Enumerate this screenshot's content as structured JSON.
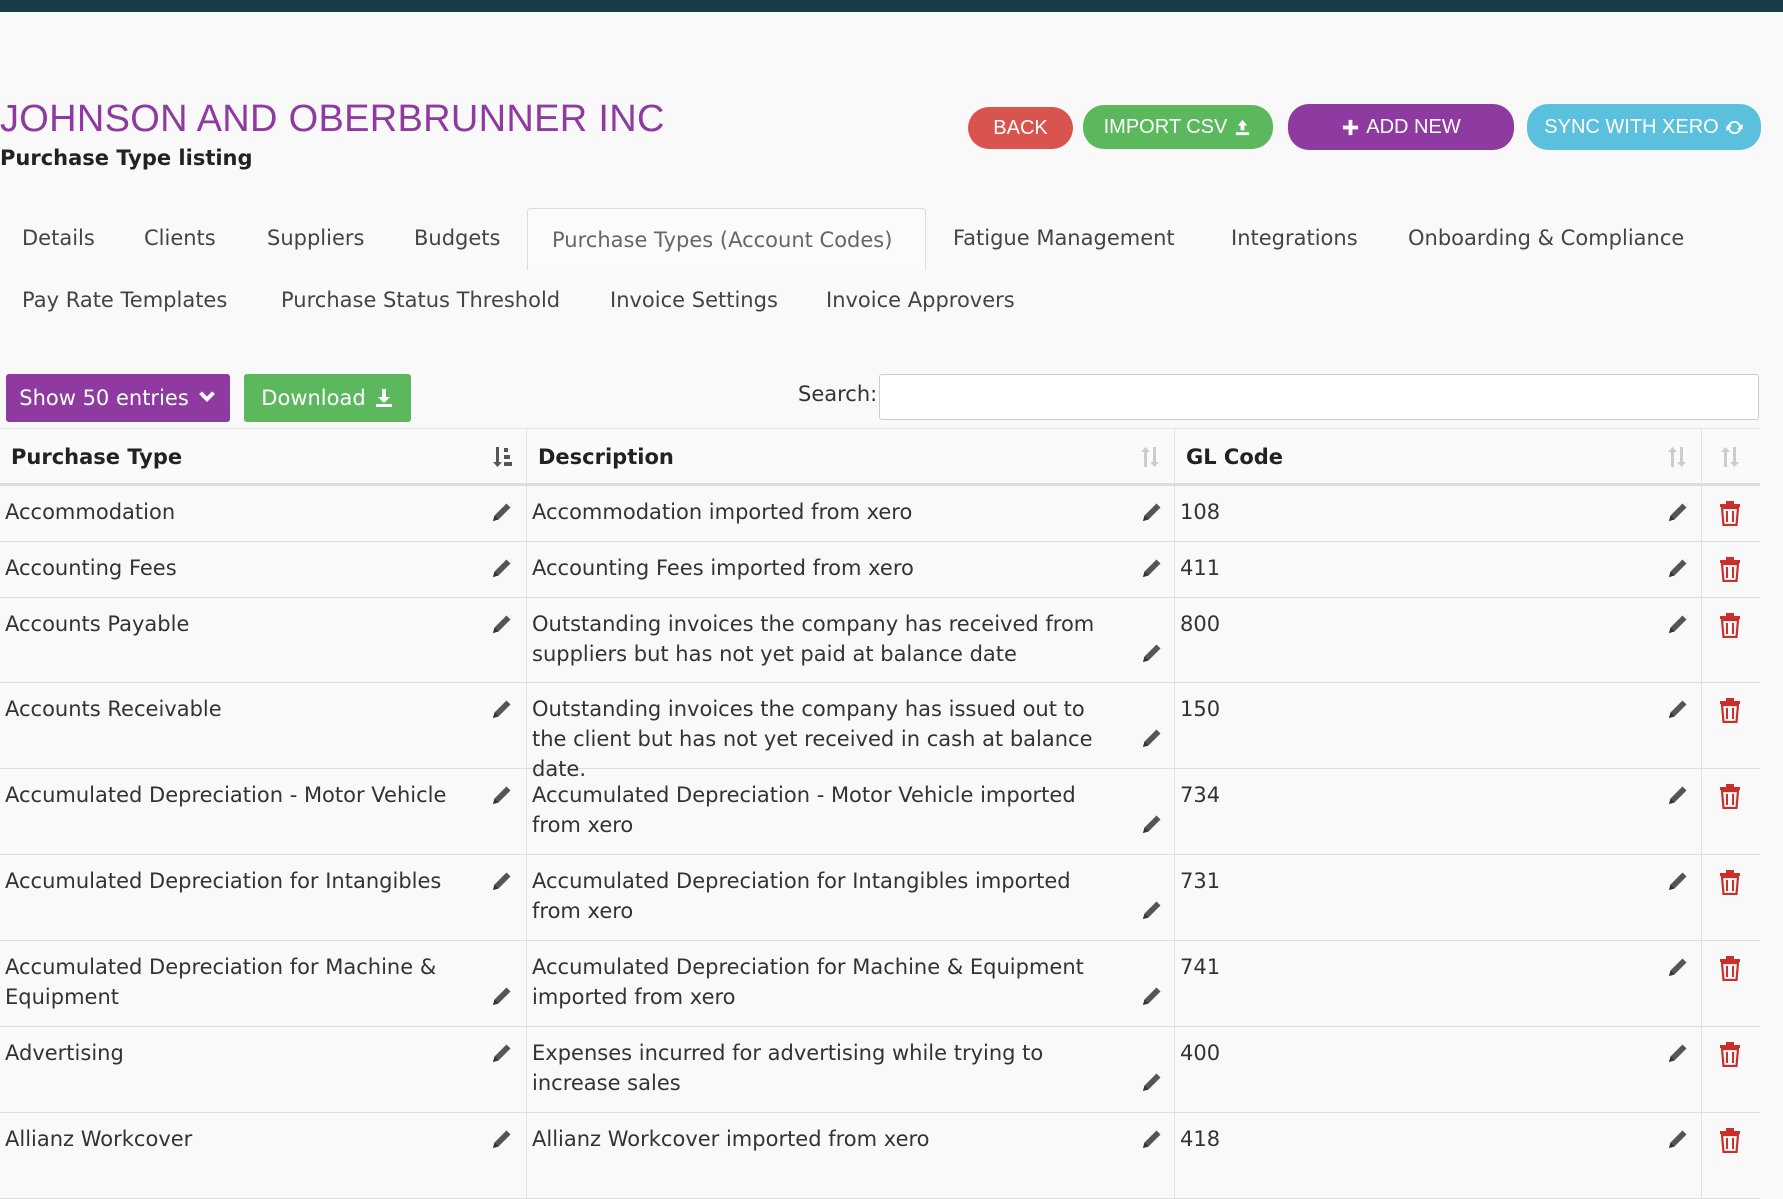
{
  "header": {
    "company": "JOHNSON AND OBERBRUNNER INC",
    "subtitle": "Purchase Type listing",
    "buttons": {
      "back": "BACK",
      "import": "IMPORT CSV",
      "add": "ADD NEW",
      "sync": "SYNC WITH XERO"
    }
  },
  "tabs": [
    {
      "label": "Details"
    },
    {
      "label": "Clients"
    },
    {
      "label": "Suppliers"
    },
    {
      "label": "Budgets"
    },
    {
      "label": "Purchase Types (Account Codes)",
      "active": true
    },
    {
      "label": "Fatigue Management"
    },
    {
      "label": "Integrations"
    },
    {
      "label": "Onboarding & Compliance"
    },
    {
      "label": "Pay Rate Templates"
    },
    {
      "label": "Purchase Status Threshold"
    },
    {
      "label": "Invoice Settings"
    },
    {
      "label": "Invoice Approvers"
    }
  ],
  "toolbar": {
    "show_entries": "Show 50 entries",
    "download": "Download",
    "search_label": "Search:",
    "search_value": ""
  },
  "table": {
    "columns": [
      "Purchase Type",
      "Description",
      "GL Code"
    ],
    "rows": [
      {
        "type": "Accommodation",
        "description": "Accommodation imported from xero",
        "code": "108"
      },
      {
        "type": "Accounting Fees",
        "description": "Accounting Fees imported from xero",
        "code": "411"
      },
      {
        "type": "Accounts Payable",
        "description": "Outstanding invoices the company has received from suppliers but has not yet paid at balance date",
        "code": "800"
      },
      {
        "type": "Accounts Receivable",
        "description": "Outstanding invoices the company has issued out to the client but has not yet received in cash at balance date.",
        "code": "150"
      },
      {
        "type": "Accumulated Depreciation - Motor Vehicle",
        "description": "Accumulated Depreciation - Motor Vehicle imported from xero",
        "code": "734"
      },
      {
        "type": "Accumulated Depreciation for Intangibles",
        "description": "Accumulated Depreciation for Intangibles imported from xero",
        "code": "731"
      },
      {
        "type": "Accumulated Depreciation for Machine & Equipment",
        "description": "Accumulated Depreciation for Machine & Equipment imported from xero",
        "code": "741"
      },
      {
        "type": "Advertising",
        "description": "Expenses incurred for advertising while trying to increase sales",
        "code": "400"
      },
      {
        "type": "Allianz Workcover",
        "description": "Allianz Workcover imported from xero",
        "code": "418"
      }
    ]
  },
  "colors": {
    "brand_purple": "#8e3aa0",
    "back_red": "#d9534f",
    "green": "#5cb85c",
    "cyan": "#5bc0de",
    "trash_red": "#c9302c"
  }
}
